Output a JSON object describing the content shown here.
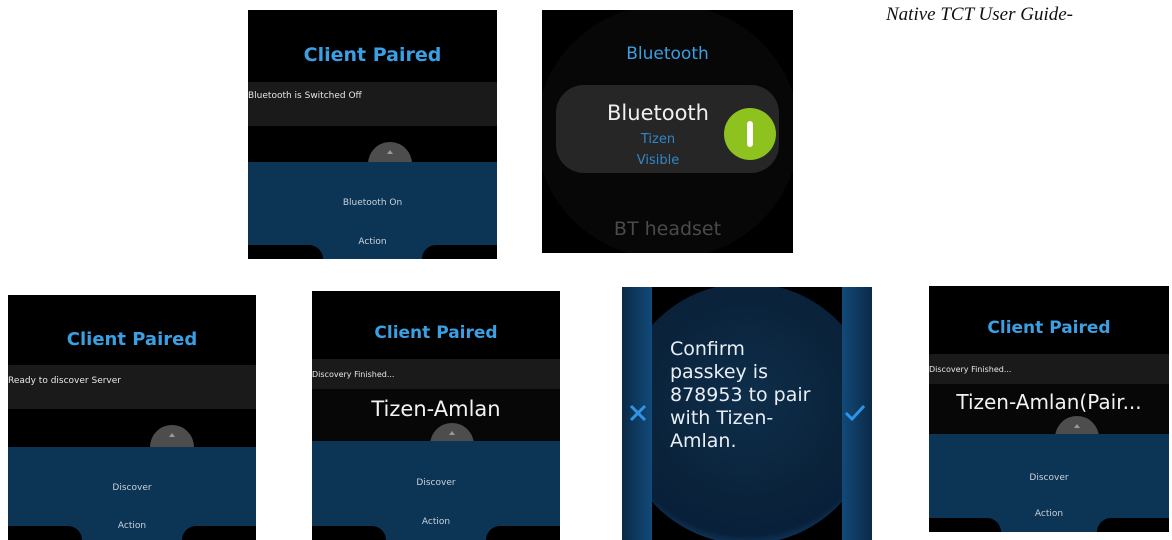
{
  "header": {
    "text": "Native TCT User Guide-"
  },
  "screens": {
    "bt_off": {
      "title": "Client Paired",
      "status": "Bluetooth is Switched Off",
      "button": "Bluetooth On",
      "action": "Action"
    },
    "bt_settings": {
      "title": "Bluetooth",
      "item_label": "Bluetooth",
      "sub1": "Tizen",
      "sub2": "Visible",
      "next_item": "BT headset",
      "toggle_state": "on"
    },
    "ready": {
      "title": "Client Paired",
      "status": "Ready to discover Server",
      "button": "Discover",
      "action": "Action"
    },
    "finished": {
      "title": "Client Paired",
      "status": "Discovery Finished...",
      "device": "Tizen-Amlan",
      "button": "Discover",
      "action": "Action"
    },
    "passkey": {
      "message": "Confirm\npasskey is\n878953 to pair\nwith Tizen-\nAmlan.",
      "cancel_icon": "close-icon",
      "confirm_icon": "check-icon"
    },
    "paired": {
      "title": "Client Paired",
      "status": "Discovery Finished...",
      "device": "Tizen-Amlan(Pair...",
      "button": "Discover",
      "action": "Action"
    }
  },
  "colors": {
    "title_blue": "#3a9fe3",
    "panel_navy": "#0c3455",
    "toggle_green": "#8dc21f"
  }
}
